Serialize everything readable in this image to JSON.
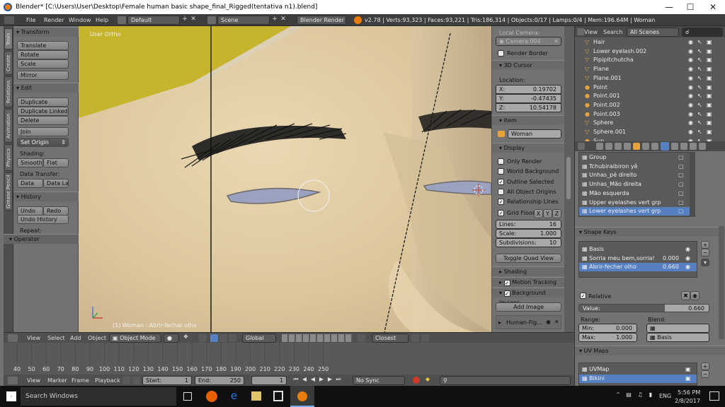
{
  "window": {
    "title": "Blender* [C:\\Users\\User\\Desktop\\Female human basic shape_final_Rigged(tentativa n1).blend]"
  },
  "info_header": {
    "menus": [
      "File",
      "Render",
      "Window",
      "Help"
    ],
    "layout": "Default",
    "scene": "Scene",
    "engine": "Blender Render",
    "stats": "v2.78 | Verts:93,323 | Faces:93,221 | Tris:186,314 | Objects:0/17 | Lamps:0/4 | Mem:196.64M | Woman"
  },
  "tabs": [
    "Tools",
    "Create",
    "Relations",
    "Animation",
    "Physics",
    "Grease Pencil"
  ],
  "toolshelf": {
    "transform_header": "Transform",
    "translate": "Translate",
    "rotate": "Rotate",
    "scale": "Scale",
    "mirror": "Mirror",
    "edit_header": "Edit",
    "duplicate": "Duplicate",
    "duplicate_linked": "Duplicate Linked",
    "delete": "Delete",
    "join": "Join",
    "set_origin": "Set Origin",
    "shading_label": "Shading:",
    "smooth": "Smooth",
    "flat": "Flat",
    "data_transfer_label": "Data Transfer:",
    "data": "Data",
    "data_lay": "Data Lay",
    "history_header": "History",
    "undo": "Undo",
    "redo": "Redo",
    "undo_history": "Undo History",
    "repeat_label": "Repeat:",
    "operator_header": "Operator"
  },
  "viewport": {
    "view_label": "User Ortho",
    "object_info": "(1) Woman : Abrir-fechar olho"
  },
  "n_panel": {
    "local_camera_label": "Local Camera:",
    "camera": "Camera.004",
    "render_border": "Render Border",
    "cursor_header": "3D Cursor",
    "location_label": "Location:",
    "x_label": "X:",
    "x": "0.19702",
    "y_label": "Y:",
    "y": "-0.47435",
    "z_label": "Z:",
    "z": "10.54178",
    "item_header": "Item",
    "item_name": "Woman",
    "display_header": "Display",
    "only_render": "Only Render",
    "world_background": "World Background",
    "outline_selected": "Outline Selected",
    "all_object_origins": "All Object Origins",
    "relationship_lines": "Relationship Lines",
    "grid_floor": "Grid Floor",
    "axis_x": "X",
    "axis_y": "Y",
    "axis_z": "Z",
    "lines_label": "Lines:",
    "lines": "16",
    "scale_label": "Scale:",
    "scale": "1.000",
    "subdivisions_label": "Subdivisions:",
    "subdivisions": "10",
    "toggle_quad_view": "Toggle Quad View",
    "shading_header": "Shading",
    "motion_tracking_header": "Motion Tracking",
    "background_images_header": "Background Images",
    "add_image": "Add Image",
    "bg_image_name": "Human-Fig..."
  },
  "outliner": {
    "view_menu": "View",
    "search_menu": "Search",
    "filter": "All Scenes",
    "items": [
      "Hair",
      "Lower eyelash.002",
      "Pipipitchutcha",
      "Plane",
      "Plane.001",
      "Point",
      "Point.001",
      "Point.002",
      "Point.003",
      "Sphere",
      "Sphere.001",
      "Sun"
    ]
  },
  "properties": {
    "vertex_groups": [
      "Group",
      "Tchubiraibiron yê",
      "Unhas_pé direito",
      "Unhas_Mão direita",
      "Mão esquerda",
      "Upper eyelashes vert grp",
      "Lower eyelashes vert grp"
    ],
    "shape_keys_header": "Shape Keys",
    "shape_keys": [
      {
        "name": "Basis",
        "value": ""
      },
      {
        "name": "Sorria meu bem,sorria!",
        "value": "0.000"
      },
      {
        "name": "Abrir-fechar olho",
        "value": "0.660"
      }
    ],
    "relative": "Relative",
    "value_label": "Value:",
    "value": "0.660",
    "range_label": "Range:",
    "blend_label": "Blend:",
    "min_label": "Min:",
    "min": "0.000",
    "max_label": "Max:",
    "max": "1.000",
    "blend_basis": "Basis",
    "uv_maps_header": "UV Maps",
    "uv_maps": [
      "UVMap",
      "Bikini"
    ]
  },
  "view3d_header": {
    "view": "View",
    "select": "Select",
    "add": "Add",
    "object": "Object",
    "mode": "Object Mode",
    "orientation": "Global",
    "snap": "Closest"
  },
  "timeline": {
    "ticks": [
      "40",
      "50",
      "60",
      "70",
      "80",
      "90",
      "100",
      "110",
      "120",
      "130",
      "140",
      "150",
      "160",
      "170",
      "180",
      "190",
      "200",
      "210",
      "220",
      "230",
      "240",
      "250"
    ],
    "view": "View",
    "marker": "Marker",
    "frame": "Frame",
    "playback": "Playback",
    "start_label": "Start:",
    "start": "1",
    "end_label": "End:",
    "end": "250",
    "current": "1",
    "sync": "No Sync"
  },
  "taskbar": {
    "search": "Search Windows",
    "language": "ENG",
    "time": "5:56 PM",
    "date": "2/8/2017"
  },
  "colors": {
    "accent": "#5680c2",
    "blender_orange": "#e87d0d",
    "hair": "#c6b42c",
    "skin": "#e0cda6"
  }
}
